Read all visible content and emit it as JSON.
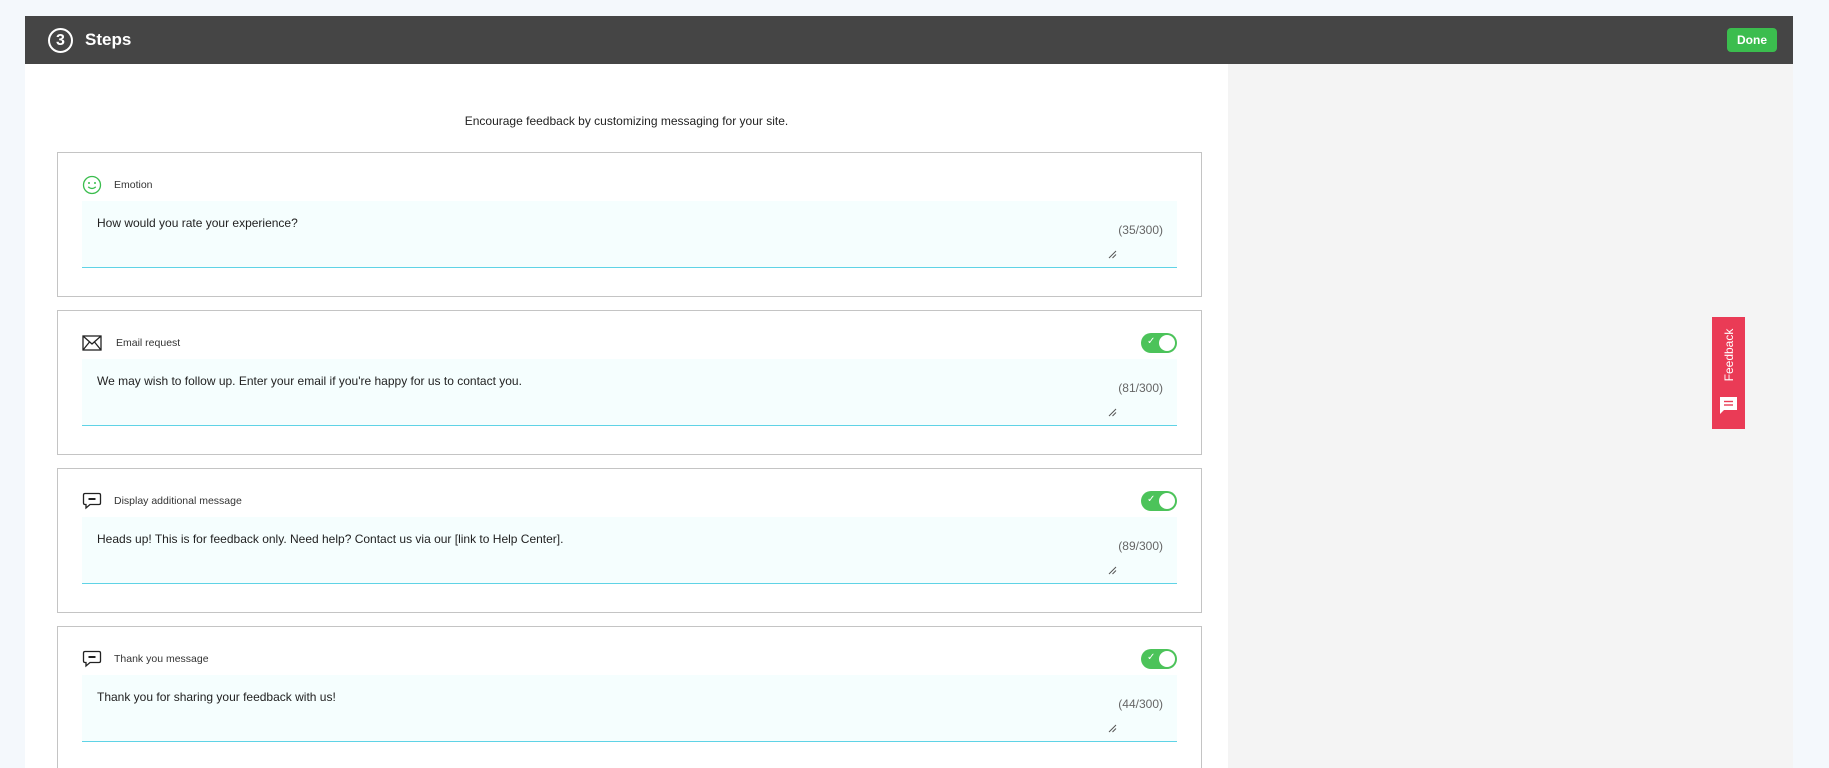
{
  "header": {
    "step_number": "3",
    "title": "Steps",
    "done_label": "Done"
  },
  "intro": "Encourage feedback by customizing messaging for your site.",
  "cards": [
    {
      "label": "Emotion",
      "icon": "smiley-icon",
      "message": "How would you rate your experience?",
      "count": "(35/300)",
      "has_toggle": false
    },
    {
      "label": "Email request",
      "icon": "envelope-icon",
      "message": "We may wish to follow up. Enter your email if you're happy for us to contact you.",
      "count": "(81/300)",
      "has_toggle": true,
      "enabled": true
    },
    {
      "label": "Display additional message",
      "icon": "chat-bubble-icon",
      "message": "Heads up! This is for feedback only. Need help? Contact us via our [link to Help Center].",
      "count": "(89/300)",
      "has_toggle": true,
      "enabled": true
    },
    {
      "label": "Thank you message",
      "icon": "chat-bubble-icon",
      "message": "Thank you for sharing your feedback with us!",
      "count": "(44/300)",
      "has_toggle": true,
      "enabled": true
    }
  ],
  "feedback_tab": {
    "label": "Feedback",
    "icon": "comment-icon"
  },
  "colors": {
    "header_bg": "#454545",
    "accent_green": "#3bbd4e",
    "toggle_green": "#4cc35a",
    "feedback_red": "#ea3b56",
    "input_underline": "#5fd3e6"
  }
}
